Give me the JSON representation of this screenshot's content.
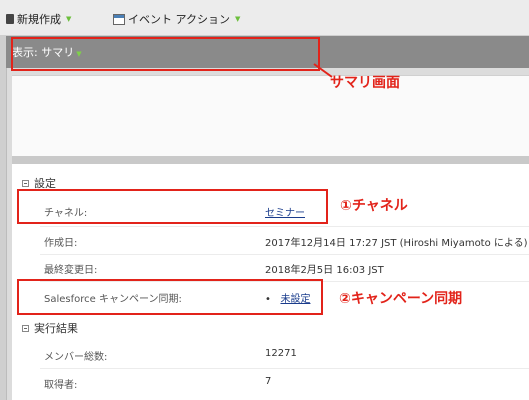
{
  "toolbar": {
    "new_label": "新規作成",
    "event_action_label": "イベント アクション"
  },
  "view_bar": {
    "label": "表示: サマリ"
  },
  "sections": {
    "settings": {
      "title": "設定",
      "rows": [
        {
          "label": "チャネル:",
          "value": "セミナー"
        },
        {
          "label": "作成日:",
          "value": "2017年12月14日 17:27 JST (Hiroshi Miyamoto による)"
        },
        {
          "label": "最終変更日:",
          "value": "2018年2月5日 16:03 JST"
        },
        {
          "label": "Salesforce キャンペーン同期:",
          "bullet": "•",
          "value": "未設定"
        }
      ]
    },
    "results": {
      "title": "実行結果",
      "rows": [
        {
          "label": "メンバー総数:",
          "value": "12271"
        },
        {
          "label": "取得者:",
          "value": "7"
        }
      ]
    }
  },
  "annotations": {
    "summary": "サマリ画面",
    "channel": "①チャネル",
    "campaign_sync": "②キャンペーン同期"
  },
  "colors": {
    "annotation": "#e2231a",
    "link": "#1a3c8c",
    "view_bar": "#8a8a8a"
  }
}
